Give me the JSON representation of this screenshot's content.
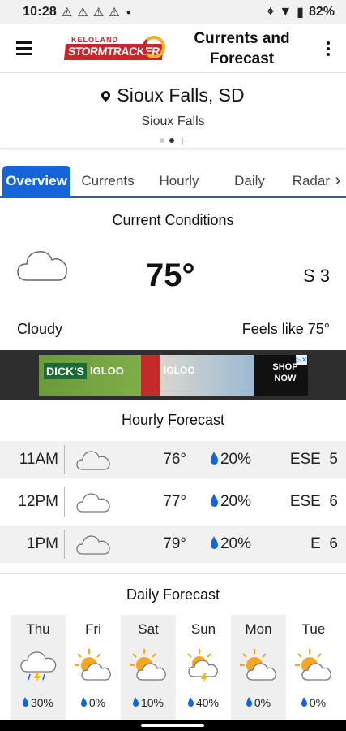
{
  "status_bar": {
    "time": "10:28",
    "battery": "82%"
  },
  "app_bar": {
    "logo_top": "KELOLAND",
    "logo_main": "STORMTRACKER",
    "title_line1": "Currents and",
    "title_line2": "Forecast"
  },
  "location": {
    "city": "Sioux Falls, SD",
    "subtitle": "Sioux Falls"
  },
  "tabs": [
    {
      "label": "Overview",
      "active": true
    },
    {
      "label": "Currents",
      "active": false
    },
    {
      "label": "Hourly",
      "active": false
    },
    {
      "label": "Daily",
      "active": false
    },
    {
      "label": "Radar",
      "active": false
    }
  ],
  "current_conditions": {
    "title": "Current Conditions",
    "temperature": "75°",
    "wind": "S 3",
    "condition": "Cloudy",
    "feels_like": "Feels like 75°",
    "icon": "cloud-icon"
  },
  "ad": {
    "brand1": "DICK'S",
    "brand2": "IGLOO",
    "brand3": "IGLOO",
    "cta_line1": "SHOP",
    "cta_line2": "NOW"
  },
  "hourly_forecast": {
    "title": "Hourly Forecast",
    "rows": [
      {
        "time": "11AM",
        "temp": "76°",
        "precip": "20%",
        "wind_dir": "ESE",
        "wind_speed": "5",
        "icon": "cloud-icon"
      },
      {
        "time": "12PM",
        "temp": "77°",
        "precip": "20%",
        "wind_dir": "ESE",
        "wind_speed": "6",
        "icon": "cloud-icon"
      },
      {
        "time": "1PM",
        "temp": "79°",
        "precip": "20%",
        "wind_dir": "E",
        "wind_speed": "6",
        "icon": "cloud-icon"
      }
    ]
  },
  "daily_forecast": {
    "title": "Daily Forecast",
    "days": [
      {
        "day": "Thu",
        "precip": "30%",
        "icon": "thunderstorm-rain-icon"
      },
      {
        "day": "Fri",
        "precip": "0%",
        "icon": "partly-sunny-icon"
      },
      {
        "day": "Sat",
        "precip": "10%",
        "icon": "partly-sunny-icon"
      },
      {
        "day": "Sun",
        "precip": "40%",
        "icon": "sun-thunderstorm-icon"
      },
      {
        "day": "Mon",
        "precip": "0%",
        "icon": "partly-sunny-icon"
      },
      {
        "day": "Tue",
        "precip": "0%",
        "icon": "partly-sunny-icon"
      }
    ]
  },
  "colors": {
    "accent": "#1565d8",
    "brand_red": "#c9252c",
    "sun_orange": "#f5a623"
  }
}
